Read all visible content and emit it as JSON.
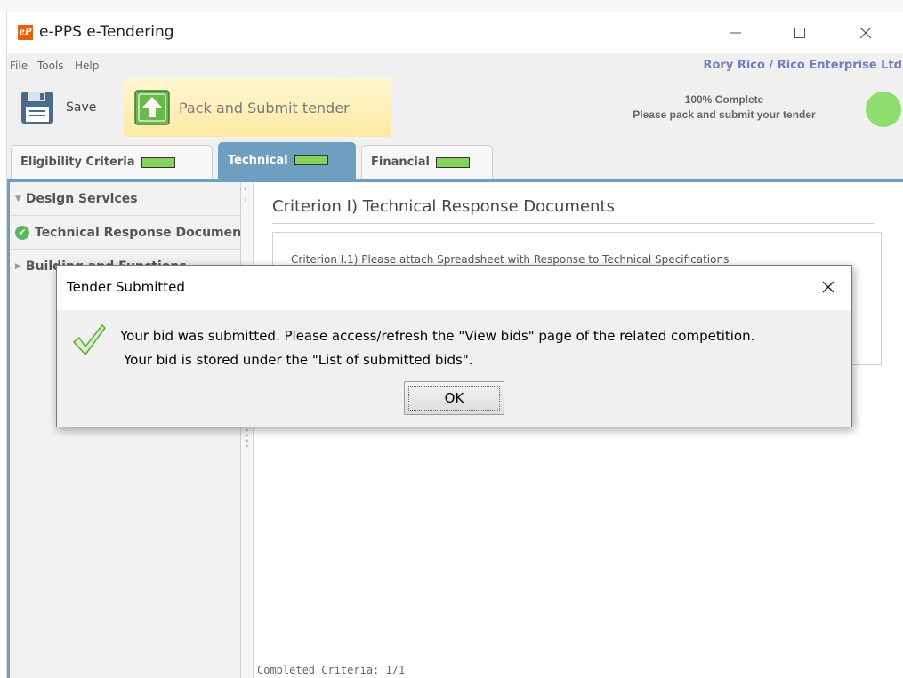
{
  "window": {
    "app_icon_text": "eP",
    "title": "e-PPS e-Tendering"
  },
  "menu": {
    "items": [
      "File",
      "Tools",
      "Help"
    ],
    "user": "Rory Rico / Rico Enterprise Ltd"
  },
  "toolbar": {
    "save_label": "Save",
    "pack_label": "Pack and Submit tender",
    "progress_line1": "100% Complete",
    "progress_line2": "Please pack and submit your tender",
    "progress_status_color": "#8fdd6e"
  },
  "tabs": [
    {
      "label": "Eligibility Criteria",
      "active": false
    },
    {
      "label": "Technical",
      "active": true
    },
    {
      "label": "Financial",
      "active": false
    }
  ],
  "left_panel": {
    "items": [
      {
        "label": "Design Services",
        "type": "group-expanded"
      },
      {
        "label": "Technical Response Documents",
        "type": "completed"
      },
      {
        "label": "Building and Functions",
        "type": "group-collapsed"
      }
    ]
  },
  "criterion": {
    "title": "Criterion I) Technical Response Documents",
    "sub_text": "Criterion I.1) Please attach Spreadsheet with Response to Technical Specifications"
  },
  "status": {
    "completed_criteria": "Completed Criteria: 1/1"
  },
  "dialog": {
    "title": "Tender Submitted",
    "message_line1": "Your bid was submitted. Please access/refresh the \"View bids\" page of the related competition.",
    "message_line2": "Your bid is stored under the \"List of submitted bids\".",
    "ok_label": "OK"
  },
  "colors": {
    "tab_active": "#6f9fc0",
    "progress_bar": "#86d25e",
    "user_text": "#6f7fbf",
    "check_green": "#5cb85c"
  }
}
